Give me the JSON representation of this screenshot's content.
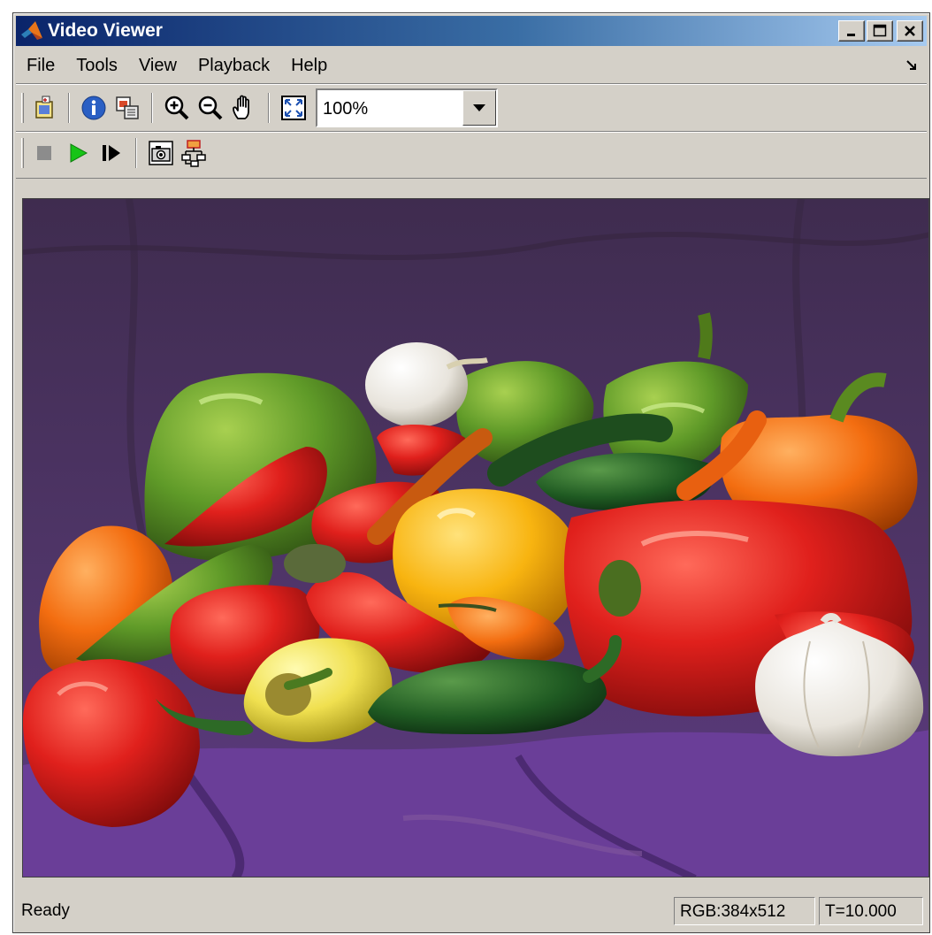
{
  "window": {
    "title": "Video Viewer",
    "title_gradient_start": "#0a246a",
    "title_gradient_end": "#a6caf0",
    "background": "#d4d0c8",
    "app_icon": "matlab-logo-icon",
    "controls": [
      "minimize-icon",
      "maximize-icon",
      "close-icon"
    ]
  },
  "menu": {
    "items": [
      "File",
      "Tools",
      "View",
      "Playback",
      "Help"
    ],
    "dock_icon": "dock-arrow-icon"
  },
  "toolbar": {
    "buttons": [
      "new-window-icon",
      "info-icon",
      "maintain-fit-icon",
      "zoom-in-icon",
      "zoom-out-icon",
      "pan-hand-icon",
      "fit-to-window-icon"
    ],
    "zoom_value": "100%",
    "zoom_dropdown_icon": "dropdown-arrow-icon"
  },
  "playback_toolbar": {
    "buttons": [
      "stop-icon",
      "play-icon",
      "step-forward-icon",
      "snapshot-camera-icon",
      "highlight-signal-icon"
    ],
    "play_color": "#17c417"
  },
  "video": {
    "image_content": "peppers"
  },
  "status": {
    "text": "Ready",
    "size_info": "RGB:384x512",
    "time_info": "T=10.000"
  }
}
